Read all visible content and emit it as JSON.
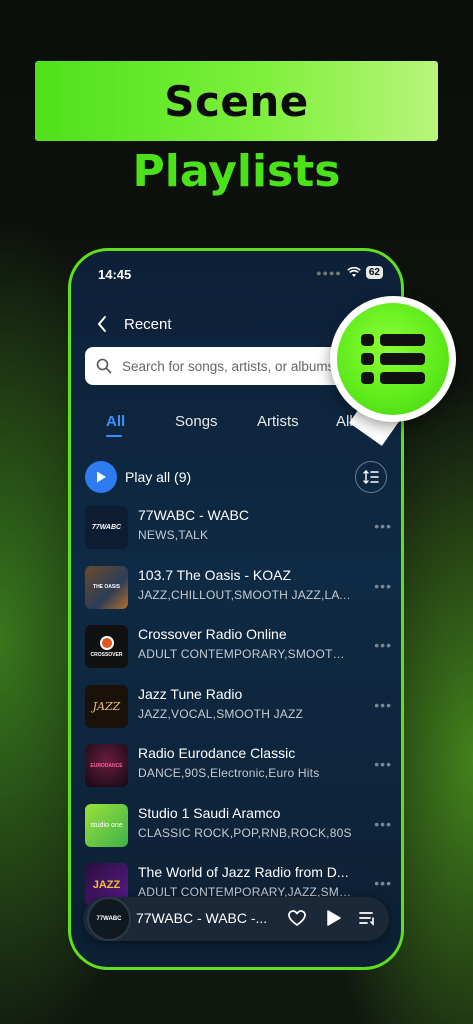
{
  "headline": "Scene",
  "subheadline": "Playlists",
  "status_bar": {
    "time": "14:45",
    "battery": "62"
  },
  "nav": {
    "title": "Recent"
  },
  "search": {
    "placeholder": "Search for songs, artists, or albums"
  },
  "tabs": [
    {
      "label": "All",
      "active": true
    },
    {
      "label": "Songs",
      "active": false
    },
    {
      "label": "Artists",
      "active": false
    },
    {
      "label": "Albums",
      "active": false
    }
  ],
  "play_all": {
    "label": "Play all",
    "count": "(9)"
  },
  "stations": [
    {
      "title": "77WABC - WABC",
      "genres": "NEWS,TALK",
      "logo": "77WABC"
    },
    {
      "title": "103.7 The Oasis - KOAZ",
      "genres": "JAZZ,CHILLOUT,SMOOTH JAZZ,LATIN JAZZ",
      "logo": "THE OASIS"
    },
    {
      "title": "Crossover Radio Online",
      "genres": "ADULT CONTEMPORARY,SMOOTH JAZZ",
      "logo": "CROSSOVER"
    },
    {
      "title": "Jazz Tune Radio",
      "genres": "JAZZ,VOCAL,SMOOTH JAZZ",
      "logo": "JAZZ"
    },
    {
      "title": "Radio Eurodance Classic",
      "genres": "DANCE,90S,Electronic,Euro Hits",
      "logo": "EURODANCE"
    },
    {
      "title": "Studio 1 Saudi Aramco",
      "genres": "CLASSIC ROCK,POP,RNB,ROCK,80S",
      "logo": "studio one"
    },
    {
      "title": "The World of Jazz Radio from D...",
      "genres": "ADULT CONTEMPORARY,JAZZ,SMOOTH JAZZ",
      "logo": "JAZZ"
    }
  ],
  "mini_player": {
    "title": "77WABC - WABC -...",
    "logo": "77WABC"
  },
  "colors": {
    "accent_green": "#5fe01f",
    "accent_blue": "#3d8ff5"
  },
  "icons": {
    "back": "chevron-left-icon",
    "search": "search-icon",
    "play": "play-icon",
    "sort": "sort-icon",
    "more": "more-dots-icon",
    "heart": "heart-icon",
    "queue": "queue-icon",
    "playlist": "list-icon"
  }
}
